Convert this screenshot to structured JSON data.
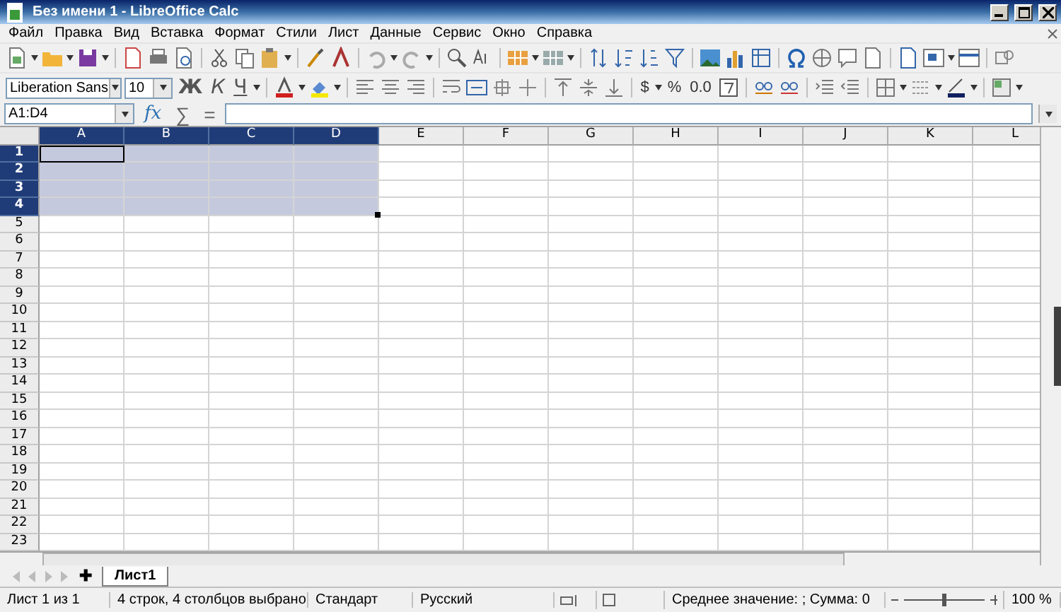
{
  "window": {
    "title": "Без имени 1 - LibreOffice Calc"
  },
  "menu": [
    "Файл",
    "Правка",
    "Вид",
    "Вставка",
    "Формат",
    "Стили",
    "Лист",
    "Данные",
    "Сервис",
    "Окно",
    "Справка"
  ],
  "format_toolbar": {
    "font_name": "Liberation Sans",
    "font_size": "10",
    "bold": "Ж",
    "italic": "К",
    "underline": "Ч",
    "currency": "$",
    "percent": "%",
    "number": "0.0"
  },
  "formula_bar": {
    "name_box": "A1:D4",
    "function_wizard": "fx",
    "sum": "∑",
    "equals": "="
  },
  "columns": [
    {
      "label": "A",
      "selected": true
    },
    {
      "label": "B",
      "selected": true
    },
    {
      "label": "C",
      "selected": true
    },
    {
      "label": "D",
      "selected": true
    },
    {
      "label": "E",
      "selected": false
    },
    {
      "label": "F",
      "selected": false
    },
    {
      "label": "G",
      "selected": false
    },
    {
      "label": "H",
      "selected": false
    },
    {
      "label": "I",
      "selected": false
    },
    {
      "label": "J",
      "selected": false
    },
    {
      "label": "K",
      "selected": false
    },
    {
      "label": "L",
      "selected": false
    }
  ],
  "rows": [
    {
      "label": "1",
      "selected": true
    },
    {
      "label": "2",
      "selected": true
    },
    {
      "label": "3",
      "selected": true
    },
    {
      "label": "4",
      "selected": true
    },
    {
      "label": "5",
      "selected": false
    },
    {
      "label": "6",
      "selected": false
    },
    {
      "label": "7",
      "selected": false
    },
    {
      "label": "8",
      "selected": false
    },
    {
      "label": "9",
      "selected": false
    },
    {
      "label": "10",
      "selected": false
    },
    {
      "label": "11",
      "selected": false
    },
    {
      "label": "12",
      "selected": false
    },
    {
      "label": "13",
      "selected": false
    },
    {
      "label": "14",
      "selected": false
    },
    {
      "label": "15",
      "selected": false
    },
    {
      "label": "16",
      "selected": false
    },
    {
      "label": "17",
      "selected": false
    },
    {
      "label": "18",
      "selected": false
    },
    {
      "label": "19",
      "selected": false
    },
    {
      "label": "20",
      "selected": false
    },
    {
      "label": "21",
      "selected": false
    },
    {
      "label": "22",
      "selected": false
    },
    {
      "label": "23",
      "selected": false
    }
  ],
  "sheet_tabs": [
    {
      "label": "Лист1",
      "selected": true
    }
  ],
  "add_sheet": "✚",
  "status_bar": {
    "sheet": "Лист 1 из 1",
    "selection": "4 строк, 4 столбцов выбрано",
    "style": "Стандарт",
    "language": "Русский",
    "sum": "Среднее значение: ; Сумма: 0",
    "zoom": {
      "level": 0.5,
      "reading": "100 %"
    }
  }
}
